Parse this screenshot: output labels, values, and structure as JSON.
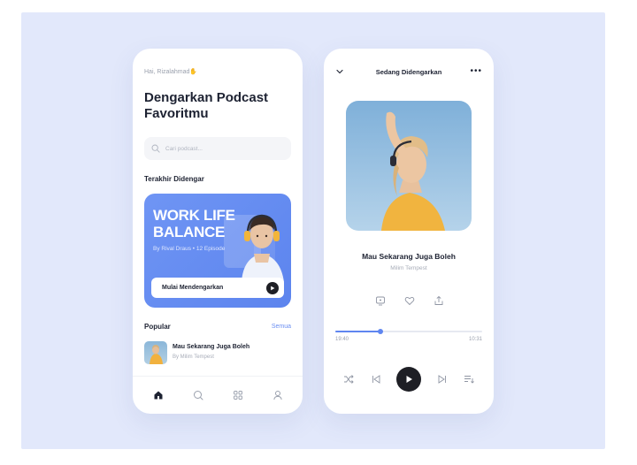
{
  "colors": {
    "background": "#e2e8fb",
    "accent": "#5f86f0",
    "banner": "#6a8ff3",
    "dark": "#1e1f25",
    "text": "#1d2232",
    "muted": "#a7acb8"
  },
  "home": {
    "greeting": "Hai, Rizalahmad",
    "greeting_icon": "waving-hand-icon",
    "title": "Dengarkan Podcast Favoritmu",
    "search": {
      "placeholder": "Cari podcast...",
      "icon": "search-icon"
    },
    "recent_section": "Terakhir Didengar",
    "featured": {
      "title": "WORK LIFE BALANCE",
      "meta": "By Rival Draus • 12 Episode",
      "cta": "Mulai Mendengarkan"
    },
    "popular_section": "Popular",
    "popular_more": "Semua",
    "popular_items": [
      {
        "title": "Mau Sekarang Juga Boleh",
        "artist": "By Milim Tempest"
      }
    ],
    "nav": [
      {
        "name": "home",
        "icon": "home-icon",
        "active": true
      },
      {
        "name": "search",
        "icon": "search-icon",
        "active": false
      },
      {
        "name": "library",
        "icon": "grid-icon",
        "active": false
      },
      {
        "name": "profile",
        "icon": "user-icon",
        "active": false
      }
    ]
  },
  "player": {
    "heading": "Sedang Didengarkan",
    "more": "•••",
    "song_title": "Mau Sekarang Juga Boleh",
    "artist": "Milim Tempest",
    "current_time": "19:40",
    "total_time": "10:31",
    "progress": 0.31,
    "actions": [
      "playlist-icon",
      "heart-icon",
      "share-icon"
    ],
    "controls": [
      "shuffle-icon",
      "previous-icon",
      "play-icon",
      "next-icon",
      "queue-icon"
    ]
  }
}
